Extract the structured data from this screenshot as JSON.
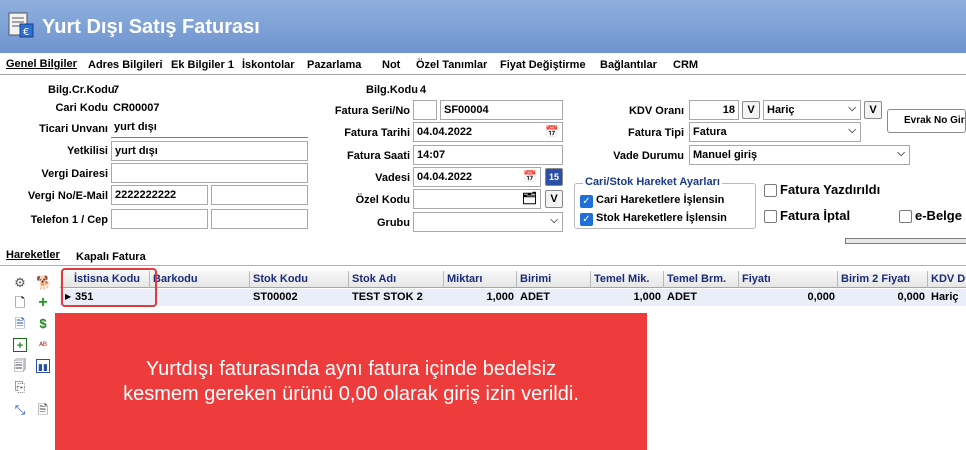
{
  "window": {
    "title": "Yurt Dışı Satış Faturası"
  },
  "menu_tabs": [
    {
      "label": "Genel Bilgiler"
    },
    {
      "label": "Adres Bilgileri"
    },
    {
      "label": "Ek Bilgiler 1"
    },
    {
      "label": "İskontolar"
    },
    {
      "label": "Pazarlama"
    },
    {
      "label": "Not"
    },
    {
      "label": "Özel Tanımlar"
    },
    {
      "label": "Fiyat Değiştirme"
    },
    {
      "label": "Bağlantılar"
    },
    {
      "label": "CRM"
    }
  ],
  "form": {
    "bilg_cr_kodu": {
      "label": "Bilg.Cr.Kodu",
      "value": "7"
    },
    "cari_kodu": {
      "label": "Cari Kodu",
      "value": "CR00007"
    },
    "ticari_unvani": {
      "label": "Ticari Unvanı",
      "value": "yurt dışı"
    },
    "yetkilisi": {
      "label": "Yetkilisi",
      "value": "yurt dışı"
    },
    "vergi_dairesi": {
      "label": "Vergi Dairesi",
      "value": ""
    },
    "vergi_no": {
      "label": "Vergi No/E-Mail",
      "value": "2222222222",
      "value2": ""
    },
    "telefon": {
      "label": "Telefon 1 / Cep",
      "value": "",
      "value2": ""
    },
    "bilg_kodu": {
      "label": "Bilg.Kodu",
      "value": "4"
    },
    "fatura_seri_no": {
      "label": "Fatura Seri/No",
      "seri": "",
      "no": "SF00004"
    },
    "fatura_tarihi": {
      "label": "Fatura Tarihi",
      "value": "04.04.2022"
    },
    "fatura_saati": {
      "label": "Fatura Saati",
      "value": "14:07"
    },
    "vadesi": {
      "label": "Vadesi",
      "value": "04.04.2022"
    },
    "ozel_kodu": {
      "label": "Özel Kodu",
      "value": "",
      "btn": "V"
    },
    "grubu": {
      "label": "Grubu",
      "value": ""
    },
    "kdv_orani": {
      "label": "KDV Oranı",
      "value": "18",
      "btn": "V",
      "mode": "Hariç",
      "btn2": "V"
    },
    "fatura_tipi": {
      "label": "Fatura Tipi",
      "value": "Fatura"
    },
    "vade_durumu": {
      "label": "Vade Durumu",
      "value": "Manuel giriş"
    },
    "evrak_button": "Evrak No Gir",
    "calendar_badge": "15"
  },
  "hareket_group": {
    "title": "Cari/Stok Hareket Ayarları",
    "items": [
      {
        "label": "Cari Hareketlere İşlensin",
        "checked": true
      },
      {
        "label": "Stok Hareketlere İşlensin",
        "checked": true
      }
    ]
  },
  "status_checks": [
    {
      "label": "Fatura Yazdırıldı",
      "checked": false
    },
    {
      "label": "Fatura İptal",
      "checked": false
    },
    {
      "label": "e-Belge",
      "checked": false
    }
  ],
  "lower_tabs": [
    {
      "label": "Hareketler"
    },
    {
      "label": "Kapalı Fatura"
    }
  ],
  "grid": {
    "columns": [
      "İstisna Kodu",
      "Barkodu",
      "Stok Kodu",
      "Stok Adı",
      "Miktarı",
      "Birimi",
      "Temel Mik.",
      "Temel Brm.",
      "Fiyatı",
      "Birim 2 Fiyatı",
      "KDV Du"
    ],
    "rows": [
      {
        "istisna": "351",
        "barkod": "",
        "stok_kodu": "ST00002",
        "stok_adi": "TEST STOK 2",
        "miktar": "1,000",
        "birim": "ADET",
        "temel_mik": "1,000",
        "temel_brm": "ADET",
        "fiyat": "0,000",
        "birim2": "0,000",
        "kdv": "Hariç"
      }
    ]
  },
  "callout": {
    "line1": "Yurtdışı faturasında aynı fatura içinde bedelsiz",
    "line2": "kesmem gereken ürünü 0,00 olarak giriş izin verildi."
  },
  "colors": {
    "title_bar": "#7a9ed6",
    "callout": "#ee3c3c",
    "highlight": "#e03a3a",
    "row_bg": "#e9eef8"
  }
}
